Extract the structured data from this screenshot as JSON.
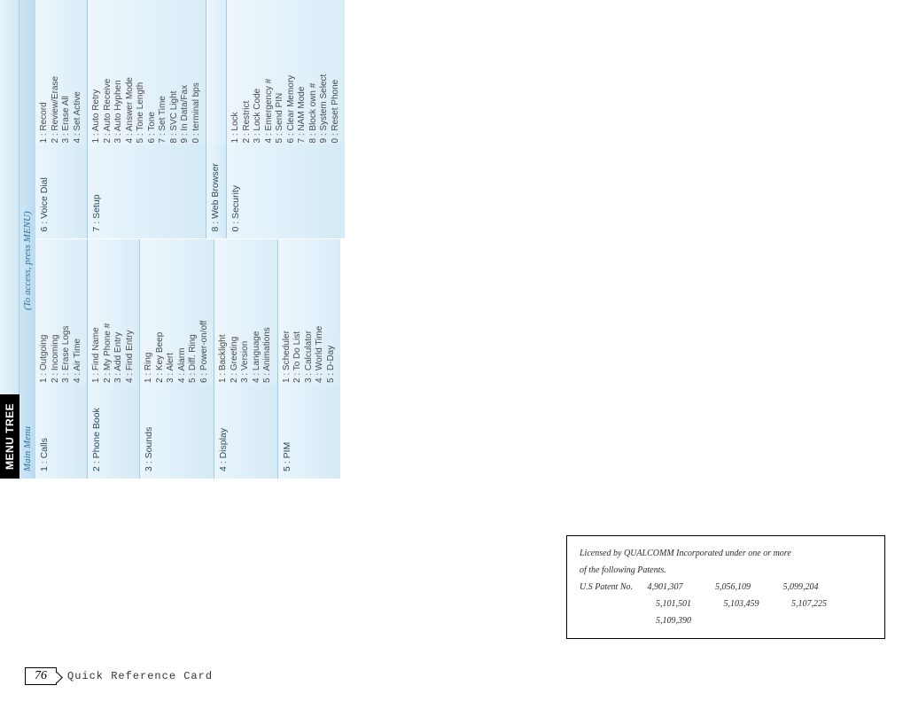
{
  "tab_title": "MENU TREE",
  "header": {
    "main_menu": "Main Menu",
    "access": "(To access, press MENU)"
  },
  "left_column": [
    {
      "title": "1 : Calls",
      "items": [
        "1 : Outgoing",
        "2 : Incoming",
        "3 : Erase Logs",
        "4 : Air Time"
      ]
    },
    {
      "title": "2 : Phone Book",
      "items": [
        "1 : Find Name",
        "2 : My Phone #",
        "3 : Add Entry",
        "4 : Find Entry"
      ]
    },
    {
      "title": "3 : Sounds",
      "items": [
        "1 : Ring",
        "2 : Key Beep",
        "3 : Alert",
        "4 : Alarm",
        "5 : Diff. Ring",
        "6 : Power-on/off"
      ]
    },
    {
      "title": "4 : Display",
      "items": [
        "1 : Backlight",
        "2 : Greeting",
        "3 : Version",
        "4 : Language",
        "5 : Animations"
      ]
    },
    {
      "title": "5 : PIM",
      "items": [
        "1 : Scheduler",
        "2 : To Do List",
        "3 : Calculator",
        "4 : World Time",
        "5 : D-Day"
      ]
    }
  ],
  "right_column": [
    {
      "title": "6 : Voice Dial",
      "items": [
        "1 : Record",
        "2 : Review/Erase",
        "3 : Erase All",
        "4 : Set Active"
      ]
    },
    {
      "title": "7 : Setup",
      "items": [
        "1 : Auto Retry",
        "2 : Auto Receive",
        "3 : Auto Hyphen",
        "4 : Answer Mode",
        "5 : Tone Length",
        "6 : Tone",
        "7 : Set Time",
        "8 : SVC Light",
        "9 : In Data/Fax",
        "0 : terminal bps"
      ]
    },
    {
      "title": "8 : Web Browser",
      "items": []
    },
    {
      "title": "0 : Security",
      "items": [
        "1 : Lock",
        "2 : Restrict",
        "3 : Lock Code",
        "4 : Emergency #",
        "5 : Send PIN",
        "6 : Clear Memory",
        "7 : NAM Mode",
        "8 : Block own #",
        "9 : System Select",
        "0 : Reset Phone"
      ]
    }
  ],
  "patent": {
    "line1": "Licensed by QUALCOMM Incorporated under one or more",
    "line2": "of the following Patents.",
    "line3_prefix": "U.S Patent No.",
    "row1": [
      "4,901,307",
      "5,056,109",
      "5,099,204"
    ],
    "row2": [
      "5,101,501",
      "5,103,459",
      "5,107,225"
    ],
    "row3": [
      "5,109,390"
    ]
  },
  "footer": {
    "page": "76",
    "text": "Quick Reference Card"
  }
}
